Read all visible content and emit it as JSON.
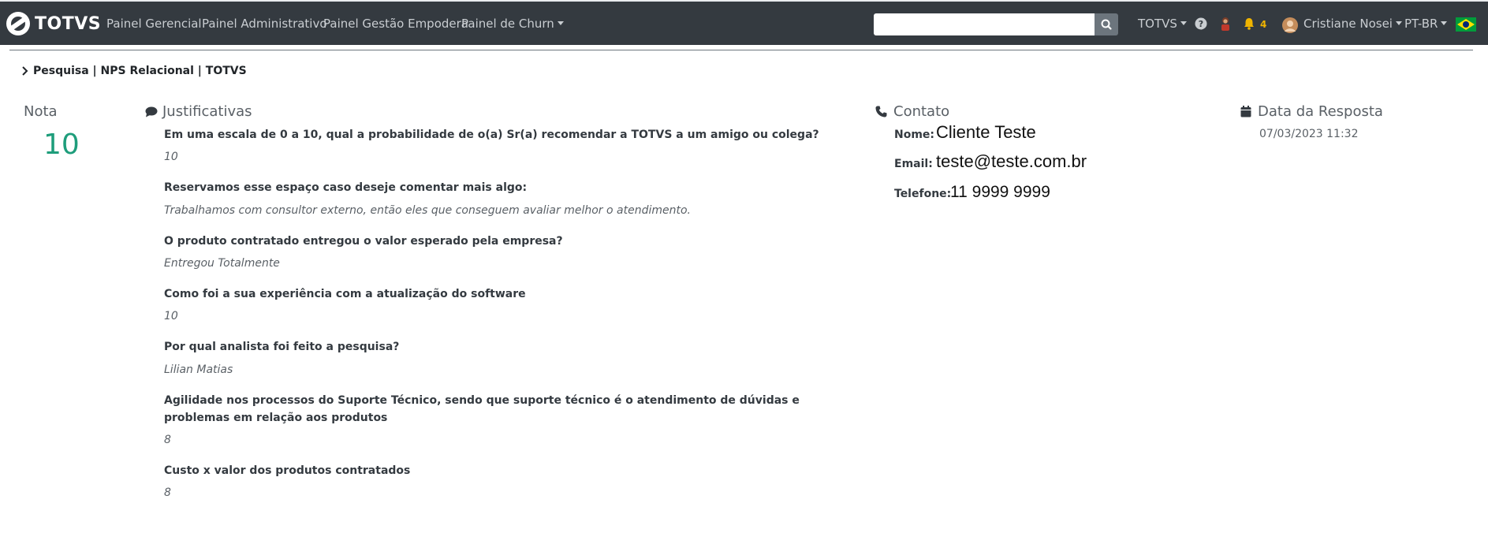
{
  "nav": {
    "brand": "TOTVS",
    "links": [
      "Painel Gerencial",
      "Painel Administrativo",
      "Painel Gestão Empodera",
      "Painel de Churn"
    ],
    "search_placeholder": "",
    "org": "TOTVS",
    "notifications_count": "4",
    "user_name": "Cristiane Nosei",
    "language": "PT-BR"
  },
  "breadcrumb": "Pesquisa | NPS Relacional | TOTVS",
  "nota": {
    "title": "Nota",
    "value": "10"
  },
  "justificativas": {
    "title": "Justificativas",
    "items": [
      {
        "q": "Em uma escala de 0 a 10, qual a probabilidade de o(a) Sr(a) recomendar a TOTVS a um amigo ou colega?",
        "a": "10"
      },
      {
        "q": "Reservamos esse espaço caso deseje comentar mais algo:",
        "a": "Trabalhamos com consultor externo, então eles que conseguem avaliar melhor o atendimento."
      },
      {
        "q": "O produto contratado entregou o valor esperado pela empresa?",
        "a": "Entregou Totalmente"
      },
      {
        "q": "Como foi a sua experiência com a atualização do software",
        "a": "10"
      },
      {
        "q": "Por qual analista foi feito a pesquisa?",
        "a": "Lilian Matias"
      },
      {
        "q": "Agilidade nos processos do Suporte Técnico, sendo que suporte técnico é o atendimento de dúvidas e problemas em relação aos produtos",
        "a": "8"
      },
      {
        "q": "Custo x valor dos produtos contratados",
        "a": "8"
      }
    ]
  },
  "contato": {
    "title": "Contato",
    "nome_label": "Nome:",
    "nome": "Cliente Teste",
    "email_label": "Email:",
    "email": "teste@teste.com.br",
    "telefone_label": "Telefone:",
    "telefone": "11 9999 9999"
  },
  "data_resposta": {
    "title": "Data da Resposta",
    "value": "07/03/2023 11:32"
  },
  "colors": {
    "navbar": "#343a40",
    "score": "#1e9d7b",
    "bell": "#f0b400"
  }
}
